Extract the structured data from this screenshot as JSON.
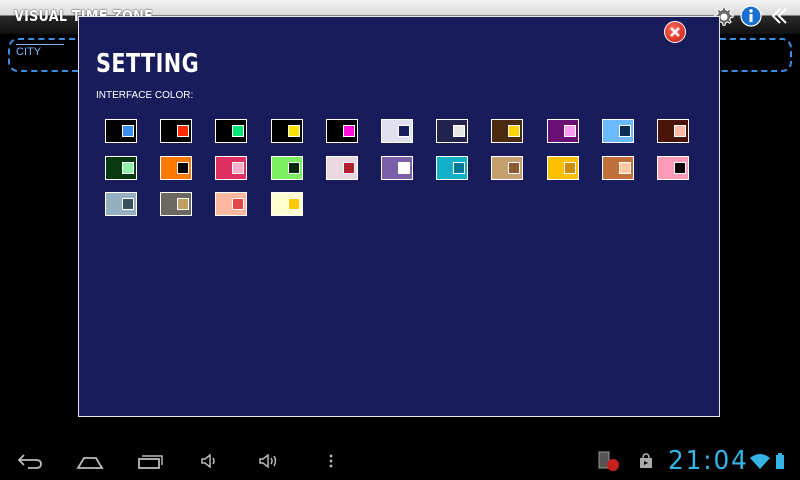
{
  "app": {
    "title": "VISUAL TIME ZONE"
  },
  "city_input": {
    "value": "CITY"
  },
  "dialog": {
    "title": "SETTING",
    "section_label": "INTERFACE COLOR:"
  },
  "swatches": [
    {
      "outer": "#000000",
      "inner": "#3a8ef0"
    },
    {
      "outer": "#000000",
      "inner": "#ff2a00"
    },
    {
      "outer": "#000000",
      "inner": "#00e676"
    },
    {
      "outer": "#000000",
      "inner": "#ffe000"
    },
    {
      "outer": "#000000",
      "inner": "#ff10d8"
    },
    {
      "outer": "#e0e0ef",
      "inner": "#1a1d5c"
    },
    {
      "outer": "#22224a",
      "inner": "#e6e6e6"
    },
    {
      "outer": "#4a2a10",
      "inner": "#ffd400"
    },
    {
      "outer": "#6a1075",
      "inner": "#ff9cf0"
    },
    {
      "outer": "#6bbaff",
      "inner": "#0b2a55"
    },
    {
      "outer": "#4a1408",
      "inner": "#ffb8a8"
    },
    {
      "outer": "#0a3a10",
      "inner": "#90f0a8"
    },
    {
      "outer": "#ff7a00",
      "inner": "#000000"
    },
    {
      "outer": "#e03062",
      "inner": "#ffb0c8"
    },
    {
      "outer": "#7af060",
      "inner": "#0c2a08"
    },
    {
      "outer": "#ead8e0",
      "inner": "#b02030"
    },
    {
      "outer": "#7a60a8",
      "inner": "#ffffff"
    },
    {
      "outer": "#10b0c8",
      "inner": "#087a98"
    },
    {
      "outer": "#c4a070",
      "inner": "#8a5a30"
    },
    {
      "outer": "#ffc000",
      "inner": "#d08a10"
    },
    {
      "outer": "#c0703a",
      "inner": "#ffc8a0"
    },
    {
      "outer": "#ff9ab8",
      "inner": "#100408"
    },
    {
      "outer": "#94afbf",
      "inner": "#3a4e5c"
    },
    {
      "outer": "#6a6660",
      "inner": "#c0a060"
    },
    {
      "outer": "#ffb8a0",
      "inner": "#e04848"
    },
    {
      "outer": "#ffffd0",
      "inner": "#ffc800"
    }
  ],
  "icons": {
    "settings": "gear-icon",
    "info": "info-icon",
    "back": "chevron-left-icon",
    "close": "close-icon"
  },
  "status": {
    "time": "21:04"
  },
  "colors": {
    "dialog_bg": "#191c5a",
    "accent": "#3a8ee6",
    "clock": "#36b4e5"
  }
}
